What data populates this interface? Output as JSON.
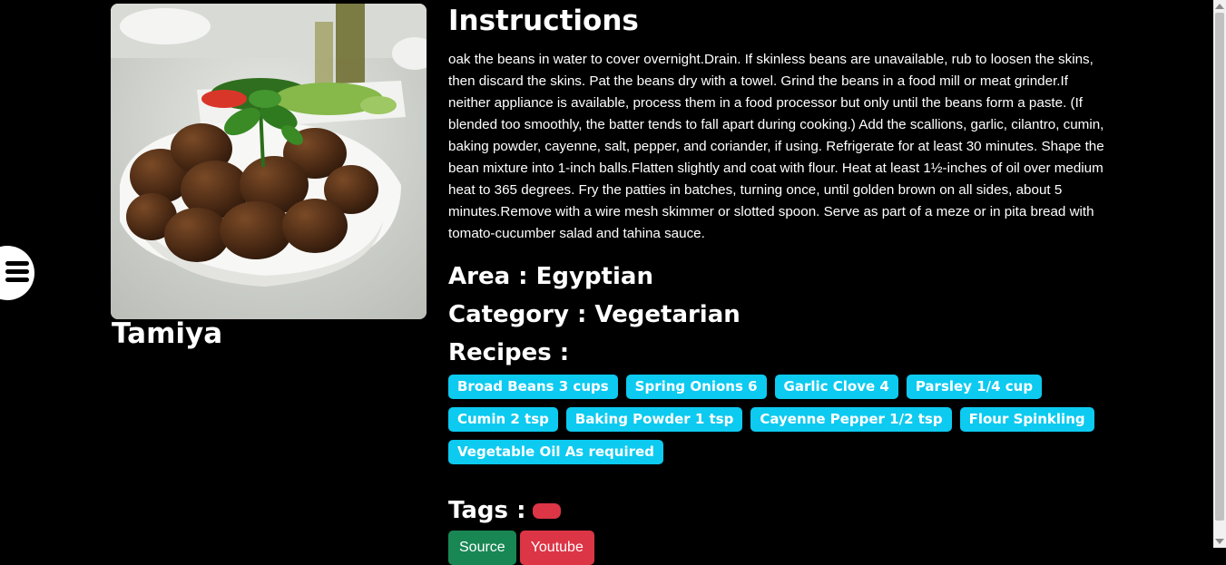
{
  "meal": {
    "name": "Tamiya",
    "image_alt": "Tamiya"
  },
  "instructions": {
    "heading": "Instructions",
    "text": "oak the beans in water to cover overnight.Drain. If skinless beans are unavailable, rub to loosen the skins, then discard the skins. Pat the beans dry with a towel. Grind the beans in a food mill or meat grinder.If neither appliance is available, process them in a food processor but only until the beans form a paste. (If blended too smoothly, the batter tends to fall apart during cooking.) Add the scallions, garlic, cilantro, cumin, baking powder, cayenne, salt, pepper, and coriander, if using. Refrigerate for at least 30 minutes. Shape the bean mixture into 1-inch balls.Flatten slightly and coat with flour. Heat at least 1½-inches of oil over medium heat to 365 degrees. Fry the patties in batches, turning once, until golden brown on all sides, about 5 minutes.Remove with a wire mesh skimmer or slotted spoon. Serve as part of a meze or in pita bread with tomato-cucumber salad and tahina sauce."
  },
  "area_line": "Area : Egyptian",
  "category_line": "Category : Vegetarian",
  "recipes": {
    "heading": "Recipes :",
    "items": [
      "Broad Beans 3 cups",
      "Spring Onions 6",
      "Garlic Clove 4",
      "Parsley 1/4 cup",
      "Cumin 2 tsp",
      "Baking Powder 1 tsp",
      "Cayenne Pepper 1/2 tsp",
      "Flour Spinkling",
      "Vegetable Oil As required"
    ]
  },
  "tags": {
    "heading": "Tags :"
  },
  "links": {
    "source_label": "Source",
    "youtube_label": "Youtube"
  },
  "icons": {
    "menu": "hamburger-menu-icon"
  },
  "colors": {
    "background": "#000000",
    "chip": "#0dcaf0",
    "source": "#198754",
    "youtube": "#dc3545",
    "tag_badge": "#dc3545"
  }
}
